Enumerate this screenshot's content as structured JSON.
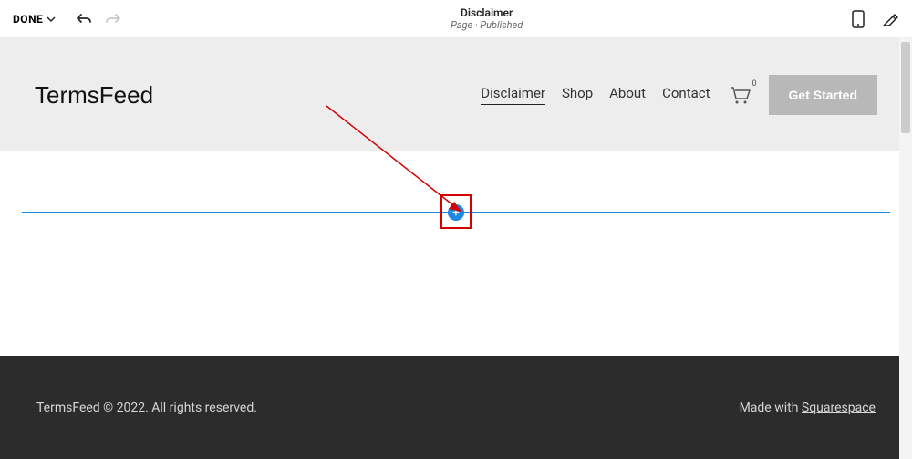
{
  "topbar": {
    "done_label": "DONE",
    "page_title": "Disclaimer",
    "page_meta": "Page · Published"
  },
  "site": {
    "brand": "TermsFeed",
    "nav": [
      {
        "label": "Disclaimer",
        "active": true
      },
      {
        "label": "Shop",
        "active": false
      },
      {
        "label": "About",
        "active": false
      },
      {
        "label": "Contact",
        "active": false
      }
    ],
    "cart_count": "0",
    "cta_label": "Get Started"
  },
  "editor": {
    "insert_symbol": "+"
  },
  "footer": {
    "copyright": "TermsFeed © 2022. All rights reserved.",
    "made_with_prefix": "Made with ",
    "made_with_link": "Squarespace"
  }
}
